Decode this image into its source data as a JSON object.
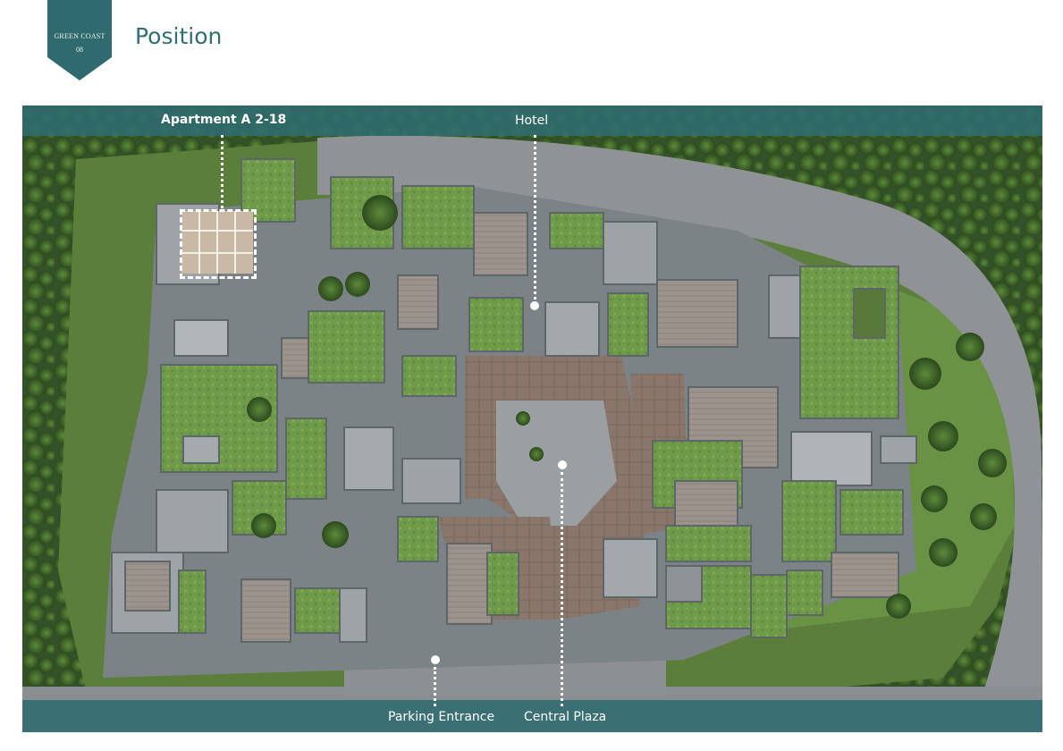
{
  "header": {
    "badge_line1": "GREEN COAST",
    "badge_line2": "08",
    "title": "Position",
    "badge_color": "#2f6b6e"
  },
  "map": {
    "labels": {
      "apartment": "Apartment A 2-18",
      "hotel": "Hotel",
      "parking": "Parking Entrance",
      "plaza": "Central Plaza"
    },
    "band_color": "#2f6b6e",
    "marker_color": "#ffffff"
  }
}
